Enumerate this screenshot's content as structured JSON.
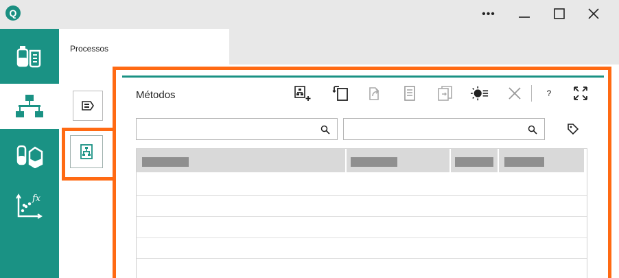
{
  "titlebar": {
    "logo_letter": "Q",
    "more_glyph": "•••",
    "minimize_glyph": "—",
    "maximize_glyph": "☐",
    "close_glyph": "✕"
  },
  "sidebar": {
    "items": [
      {
        "icon": "lab-bottles-icon"
      },
      {
        "icon": "process-hierarchy-icon",
        "active": true
      },
      {
        "icon": "sample-containers-icon"
      },
      {
        "icon": "function-chart-icon"
      }
    ]
  },
  "tab": {
    "label": "Processos"
  },
  "subnav": [
    {
      "icon": "process-step-icon"
    },
    {
      "icon": "method-document-icon",
      "active": true
    }
  ],
  "panel": {
    "title": "Métodos",
    "toolbar": [
      {
        "icon": "add-method-icon"
      },
      {
        "icon": "copy-method-icon"
      },
      {
        "icon": "export-icon"
      },
      {
        "icon": "document-icon"
      },
      {
        "icon": "transfer-icon"
      },
      {
        "icon": "activate-icon"
      },
      {
        "icon": "delete-icon"
      },
      {
        "icon": "help-icon",
        "label": "?"
      },
      {
        "icon": "expand-icon"
      }
    ],
    "search1": {
      "value": "",
      "placeholder": ""
    },
    "search2": {
      "value": "",
      "placeholder": ""
    }
  },
  "colors": {
    "accent": "#1a9284",
    "highlight": "#ff6a13",
    "titlebar": "#e8e8e8"
  }
}
